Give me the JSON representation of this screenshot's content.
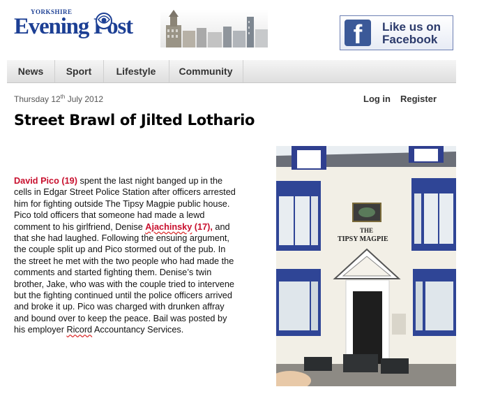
{
  "masthead": {
    "small": "YORKSHIRE",
    "main": "Evening Post"
  },
  "facebook": {
    "logo": "f",
    "line1": "Like us on",
    "line2": "Facebook"
  },
  "nav": {
    "items": [
      "News",
      "Sport",
      "Lifestyle",
      "Community"
    ]
  },
  "date": {
    "day_prefix": "Thursday 12",
    "suffix": "th",
    "rest": " July 2012"
  },
  "account": {
    "login": "Log in",
    "register": "Register"
  },
  "article": {
    "headline": "Street Brawl of Jilted Lothario",
    "name1": "David Pico (19)",
    "p1": " spent the last night banged up in the cells in Edgar Street Police Station after officers arrested him for fighting outside The Tipsy Magpie public house.  Pico told officers that someone had made a lewd comment to his girlfriend, Denise ",
    "name2a": "Ajachinsky",
    "name2b": " (17),",
    "p2": " and that she had laughed. Following the ensuing argument, the couple split up and Pico stormed out of the pub.  In the street he met with the two people who had made the comments and started fighting them. Denise’s twin brother, Jake, who was with the couple tried to intervene but the fighting continued until the police officers arrived and broke it up.  Pico was charged with drunken affray and bound over to keep the peace.  Bail was posted by his employer ",
    "employer": "Ricord",
    "p3": " Accountancy Services."
  },
  "photo": {
    "sign_line1": "THE",
    "sign_line2": "TIPSY  MAGPIE"
  }
}
